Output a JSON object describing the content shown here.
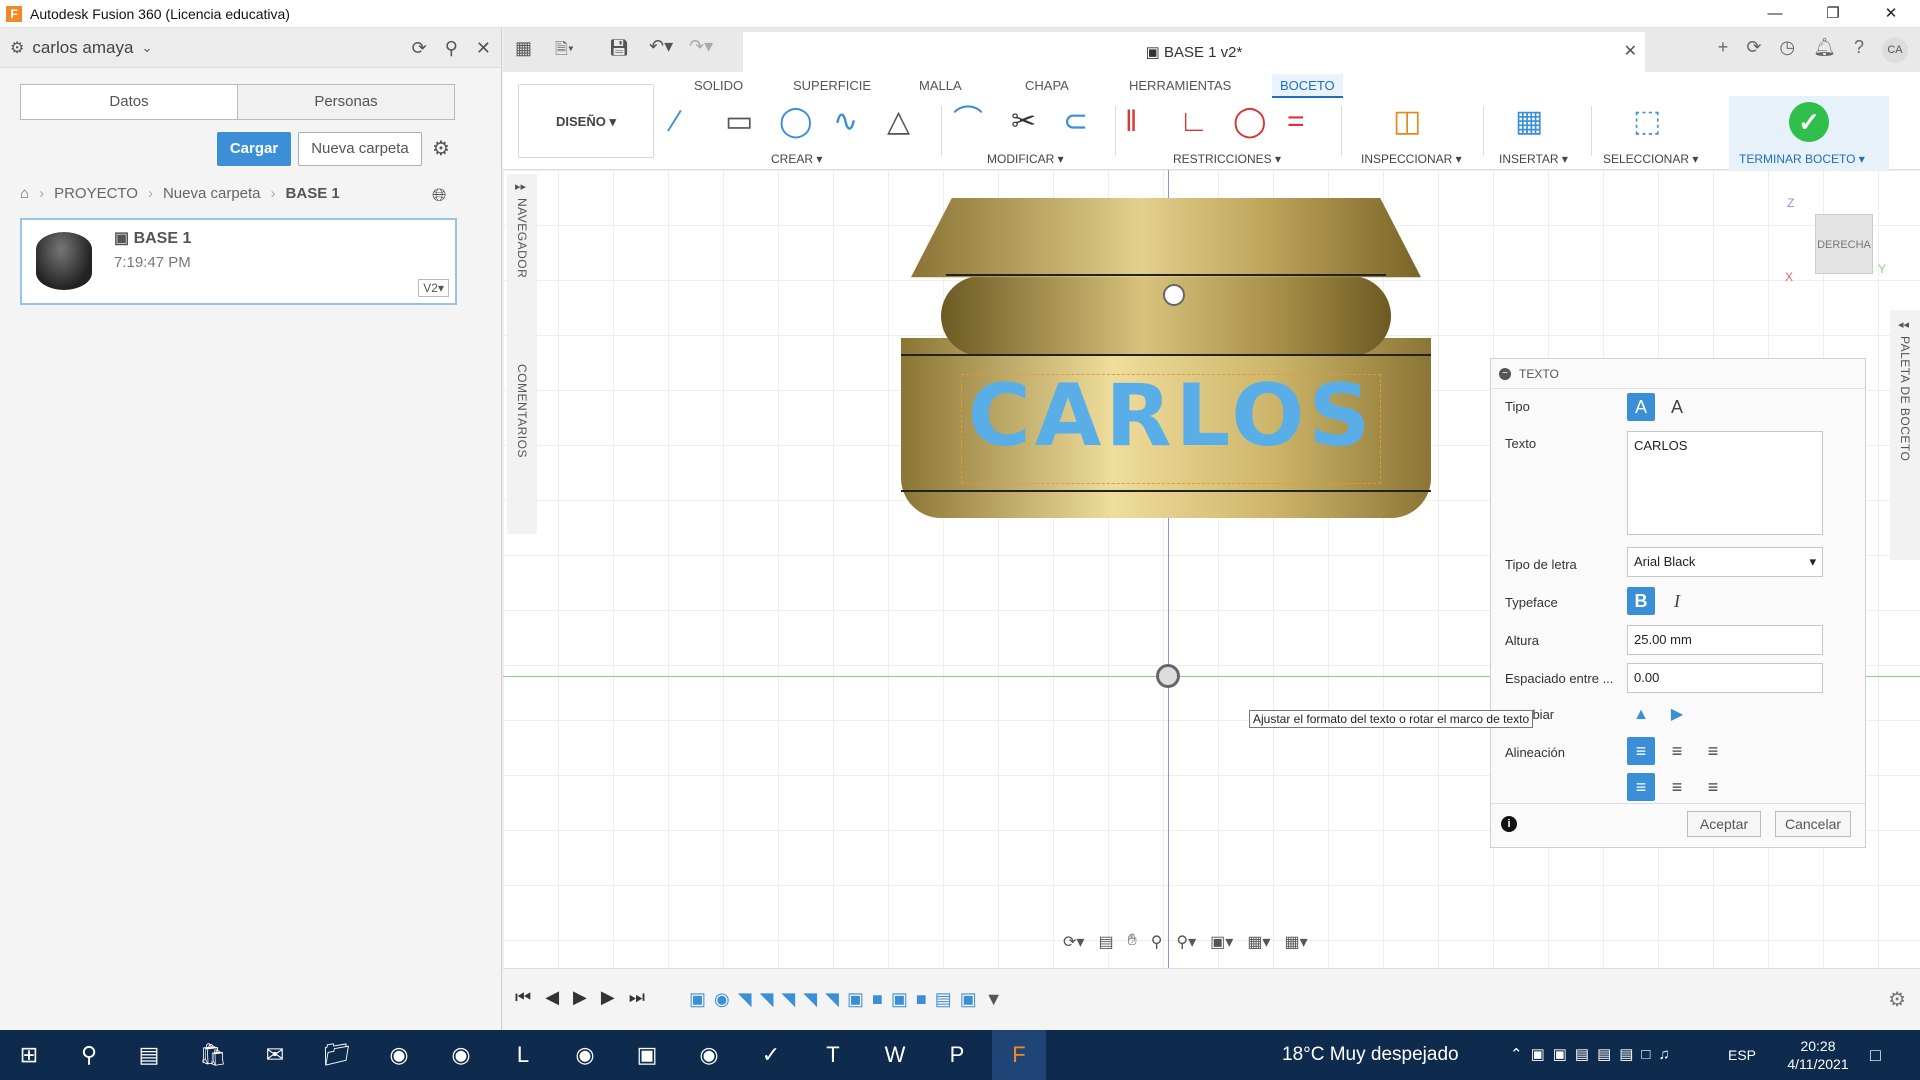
{
  "window": {
    "title": "Autodesk Fusion 360 (Licencia educativa)",
    "controls": [
      "—",
      "❐",
      "✕"
    ]
  },
  "data_panel": {
    "user": "carlos amaya",
    "tabs": [
      "Datos",
      "Personas"
    ],
    "upload_label": "Cargar",
    "new_folder_label": "Nueva carpeta",
    "breadcrumb": [
      "PROYECTO",
      "Nueva carpeta",
      "BASE 1"
    ],
    "file": {
      "name": "BASE 1",
      "time": "7:19:47 PM",
      "version": "V2▾"
    }
  },
  "document": {
    "title": "BASE 1 v2*"
  },
  "user_initials": "CA",
  "ribbon": {
    "workspace": "DISEÑO ▾",
    "tabs": [
      "SOLIDO",
      "SUPERFICIE",
      "MALLA",
      "CHAPA",
      "HERRAMIENTAS",
      "BOCETO"
    ],
    "active_tab": "BOCETO",
    "groups": [
      "CREAR ▾",
      "MODIFICAR ▾",
      "RESTRICCIONES ▾",
      "INSPECCIONAR ▾",
      "INSERTAR ▾",
      "SELECCIONAR ▾",
      "TERMINAR BOCETO ▾"
    ]
  },
  "side_labels": {
    "navigator": "NAVEGADOR",
    "comments": "COMENTARIOS",
    "palette": "PALETA DE BOCETO"
  },
  "viewcube": {
    "face": "DERECHA",
    "z": "Z",
    "y": "Y",
    "x": "X"
  },
  "sketch_text": "CARLOS",
  "text_dialog": {
    "title": "TEXTO",
    "labels": {
      "tipo": "Tipo",
      "texto": "Texto",
      "font": "Tipo de letra",
      "typeface": "Typeface",
      "height": "Altura",
      "spacing": "Espaciado entre ...",
      "flip": "Cambiar",
      "align": "Alineación"
    },
    "text_value": "CARLOS",
    "font_value": "Arial Black",
    "height_value": "25.00 mm",
    "spacing_value": "0.00",
    "ok_label": "Aceptar",
    "cancel_label": "Cancelar"
  },
  "tooltip": "Ajustar el formato del texto o rotar el marco de texto",
  "taskbar": {
    "weather": "18°C  Muy despejado",
    "lang": "ESP",
    "time": "20:28",
    "date": "4/11/2021"
  },
  "colors": {
    "accent": "#3a8fd6",
    "sketch_text": "#5aaee8",
    "taskbar": "#0e2a4d",
    "finish_check": "#2fbf4a"
  }
}
